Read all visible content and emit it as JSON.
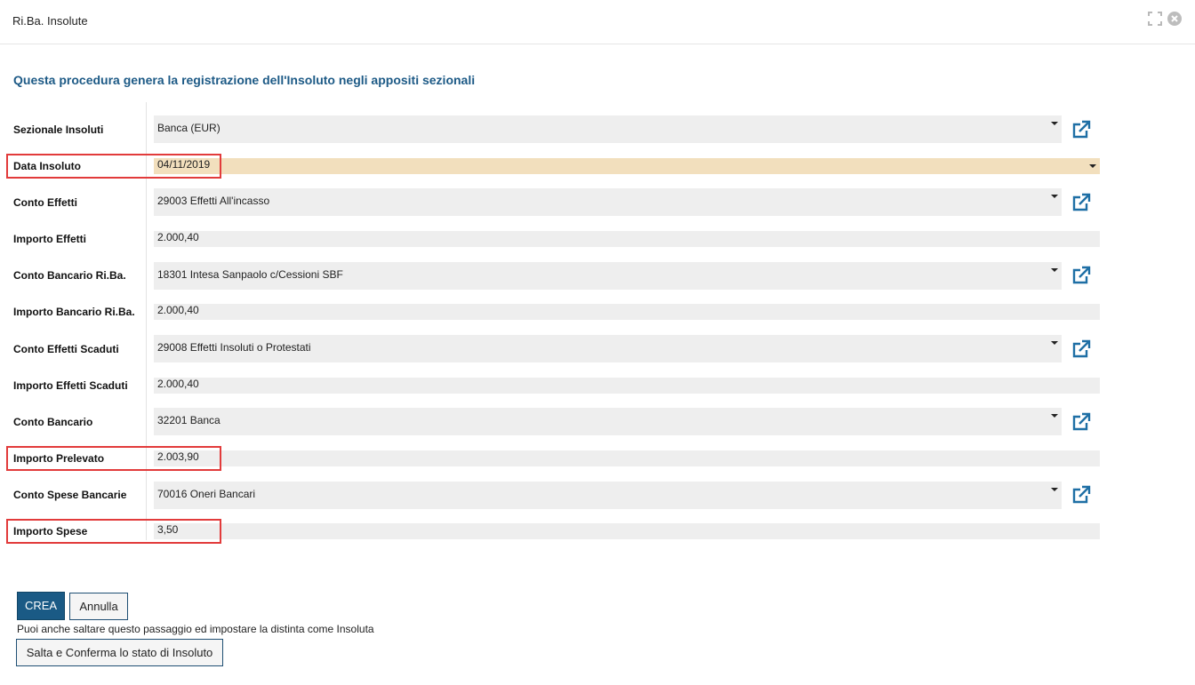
{
  "window": {
    "title": "Ri.Ba. Insolute",
    "icons": [
      "expand-icon",
      "close-circle-icon"
    ]
  },
  "intro": "Questa procedura genera la registrazione dell'Insoluto negli appositi sezionali",
  "form": {
    "sezionale_insoluti": {
      "label": "Sezionale Insoluti",
      "value": "Banca (EUR)"
    },
    "data_insoluto": {
      "label": "Data Insoluto",
      "value": "04/11/2019"
    },
    "conto_effetti": {
      "label": "Conto Effetti",
      "value": "29003 Effetti All'incasso"
    },
    "importo_effetti": {
      "label": "Importo Effetti",
      "value": "2.000,40"
    },
    "conto_bancario_riba": {
      "label": "Conto Bancario Ri.Ba.",
      "value": "18301 Intesa Sanpaolo c/Cessioni SBF"
    },
    "importo_bancario_riba": {
      "label": "Importo Bancario Ri.Ba.",
      "value": "2.000,40"
    },
    "conto_effetti_scaduti": {
      "label": "Conto Effetti Scaduti",
      "value": "29008 Effetti Insoluti o Protestati"
    },
    "importo_effetti_scaduti": {
      "label": "Importo Effetti Scaduti",
      "value": "2.000,40"
    },
    "conto_bancario": {
      "label": "Conto Bancario",
      "value": "32201 Banca"
    },
    "importo_prelevato": {
      "label": "Importo Prelevato",
      "value": "2.003,90"
    },
    "conto_spese_bancarie": {
      "label": "Conto Spese Bancarie",
      "value": "70016 Oneri Bancari"
    },
    "importo_spese": {
      "label": "Importo Spese",
      "value": "3,50"
    }
  },
  "actions": {
    "crea": "CREA",
    "annulla": "Annulla",
    "skip_note": "Puoi anche saltare questo passaggio ed impostare la distinta come Insoluta",
    "skip_button": "Salta e Conferma lo stato di Insoluto"
  },
  "colors": {
    "primary": "#1a5a85",
    "intro_text": "#1d5a86",
    "date_field_bg": "#f2dfbd",
    "field_bg": "#eeeeee",
    "highlight": "#e23b3b",
    "link_icon": "#1e6fa5"
  }
}
